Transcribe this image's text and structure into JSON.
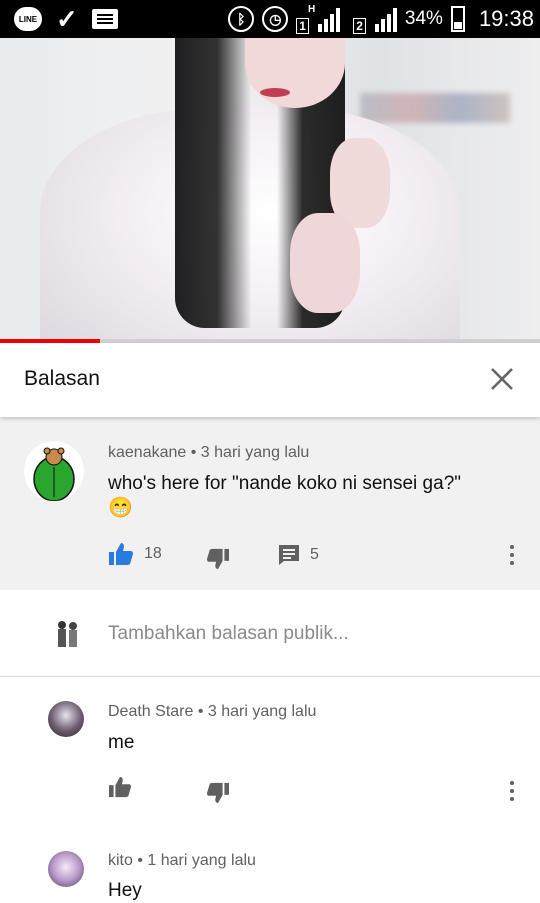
{
  "status_bar": {
    "line_label": "LINE",
    "signal_1_label": "1",
    "signal_2_label": "2",
    "network_label": "H",
    "battery": "34%",
    "time": "19:38"
  },
  "video": {
    "progress": 0.185
  },
  "panel": {
    "title": "Balasan"
  },
  "comments": [
    {
      "author": "kaenakane",
      "time": "3 hari yang lalu",
      "text": "who's here for \"nande koko ni sensei ga?\"",
      "emoji": "😁",
      "likes": "18",
      "replies": "5"
    },
    {
      "author": "Death Stare",
      "time": "3 hari yang lalu",
      "text": "me"
    },
    {
      "author": "kito",
      "time": "1 hari yang lalu",
      "text": "Hey"
    }
  ],
  "reply_box": {
    "placeholder": "Tambahkan balasan publik..."
  },
  "colors": {
    "accent_blue": "#2a7ae2",
    "progress_red": "#e00000",
    "gray_icon": "#606060"
  },
  "icons": [
    "line-icon",
    "check-icon",
    "message-icon",
    "bluetooth-icon",
    "alarm-icon",
    "signal-icon",
    "battery-icon",
    "close-icon",
    "thumbs-up-icon",
    "thumbs-down-icon",
    "comment-icon",
    "more-vert-icon"
  ]
}
